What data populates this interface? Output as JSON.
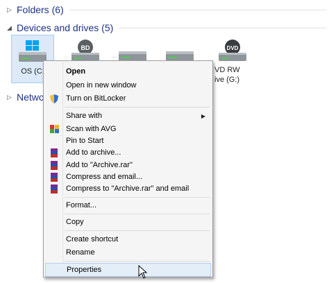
{
  "groups": {
    "folders": {
      "title": "Folders (6)",
      "chevron": "▷"
    },
    "devices": {
      "title": "Devices and drives (5)",
      "chevron": "◢"
    },
    "network": {
      "title": "Netwo",
      "chevron": "▷"
    }
  },
  "drives": [
    {
      "label": "OS (C:",
      "icon": "hdd-windows-icon"
    },
    {
      "label": "",
      "badge": "BD",
      "icon": "bd-drive-icon"
    },
    {
      "label": "",
      "icon": "hdd-icon"
    },
    {
      "label": "",
      "icon": "hdd-icon"
    },
    {
      "label": "VD RW",
      "label2": "ive (G:)",
      "badge": "DVD",
      "icon": "dvd-drive-icon"
    }
  ],
  "menu": {
    "items": [
      {
        "label": "Open",
        "icon": ""
      },
      {
        "label": "Open in new window",
        "icon": ""
      },
      {
        "label": "Turn on BitLocker",
        "icon": "shield-icon"
      },
      {
        "label": "Share with",
        "icon": "",
        "arrow": "▶"
      },
      {
        "label": "Scan with AVG",
        "icon": "avg-icon"
      },
      {
        "label": "Pin to Start",
        "icon": ""
      },
      {
        "label": "Add to archive...",
        "icon": "winrar-icon"
      },
      {
        "label": "Add to \"Archive.rar\"",
        "icon": "winrar-icon"
      },
      {
        "label": "Compress and email...",
        "icon": "winrar-icon"
      },
      {
        "label": "Compress to \"Archive.rar\" and email",
        "icon": "winrar-icon"
      },
      {
        "label": "Format...",
        "icon": ""
      },
      {
        "label": "Copy",
        "icon": ""
      },
      {
        "label": "Create shortcut",
        "icon": ""
      },
      {
        "label": "Rename",
        "icon": ""
      },
      {
        "label": "Properties",
        "icon": ""
      }
    ]
  },
  "colors": {
    "accent": "#1e3287",
    "selection": "#dbe9f8",
    "hover": "#e4eef9"
  }
}
